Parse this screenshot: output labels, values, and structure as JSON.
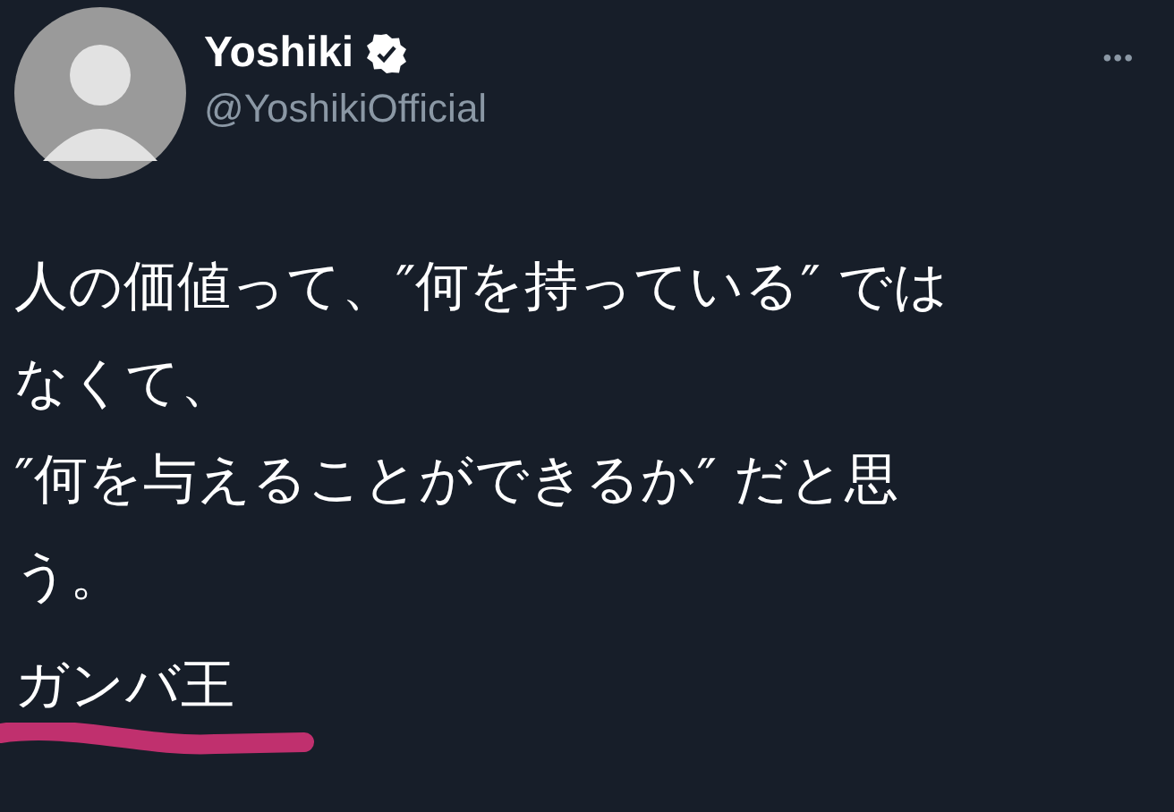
{
  "author": {
    "name": "Yoshiki",
    "verified": true,
    "handle": "@YoshikiOfficial"
  },
  "more_button": "•••",
  "text_lines": [
    "人の価値って、″何を持っている″ では",
    "なくて、",
    "″何を与えることができるか″ だと思",
    "う。"
  ],
  "signature": {
    "text": "ガンバ王",
    "underlined": true
  }
}
